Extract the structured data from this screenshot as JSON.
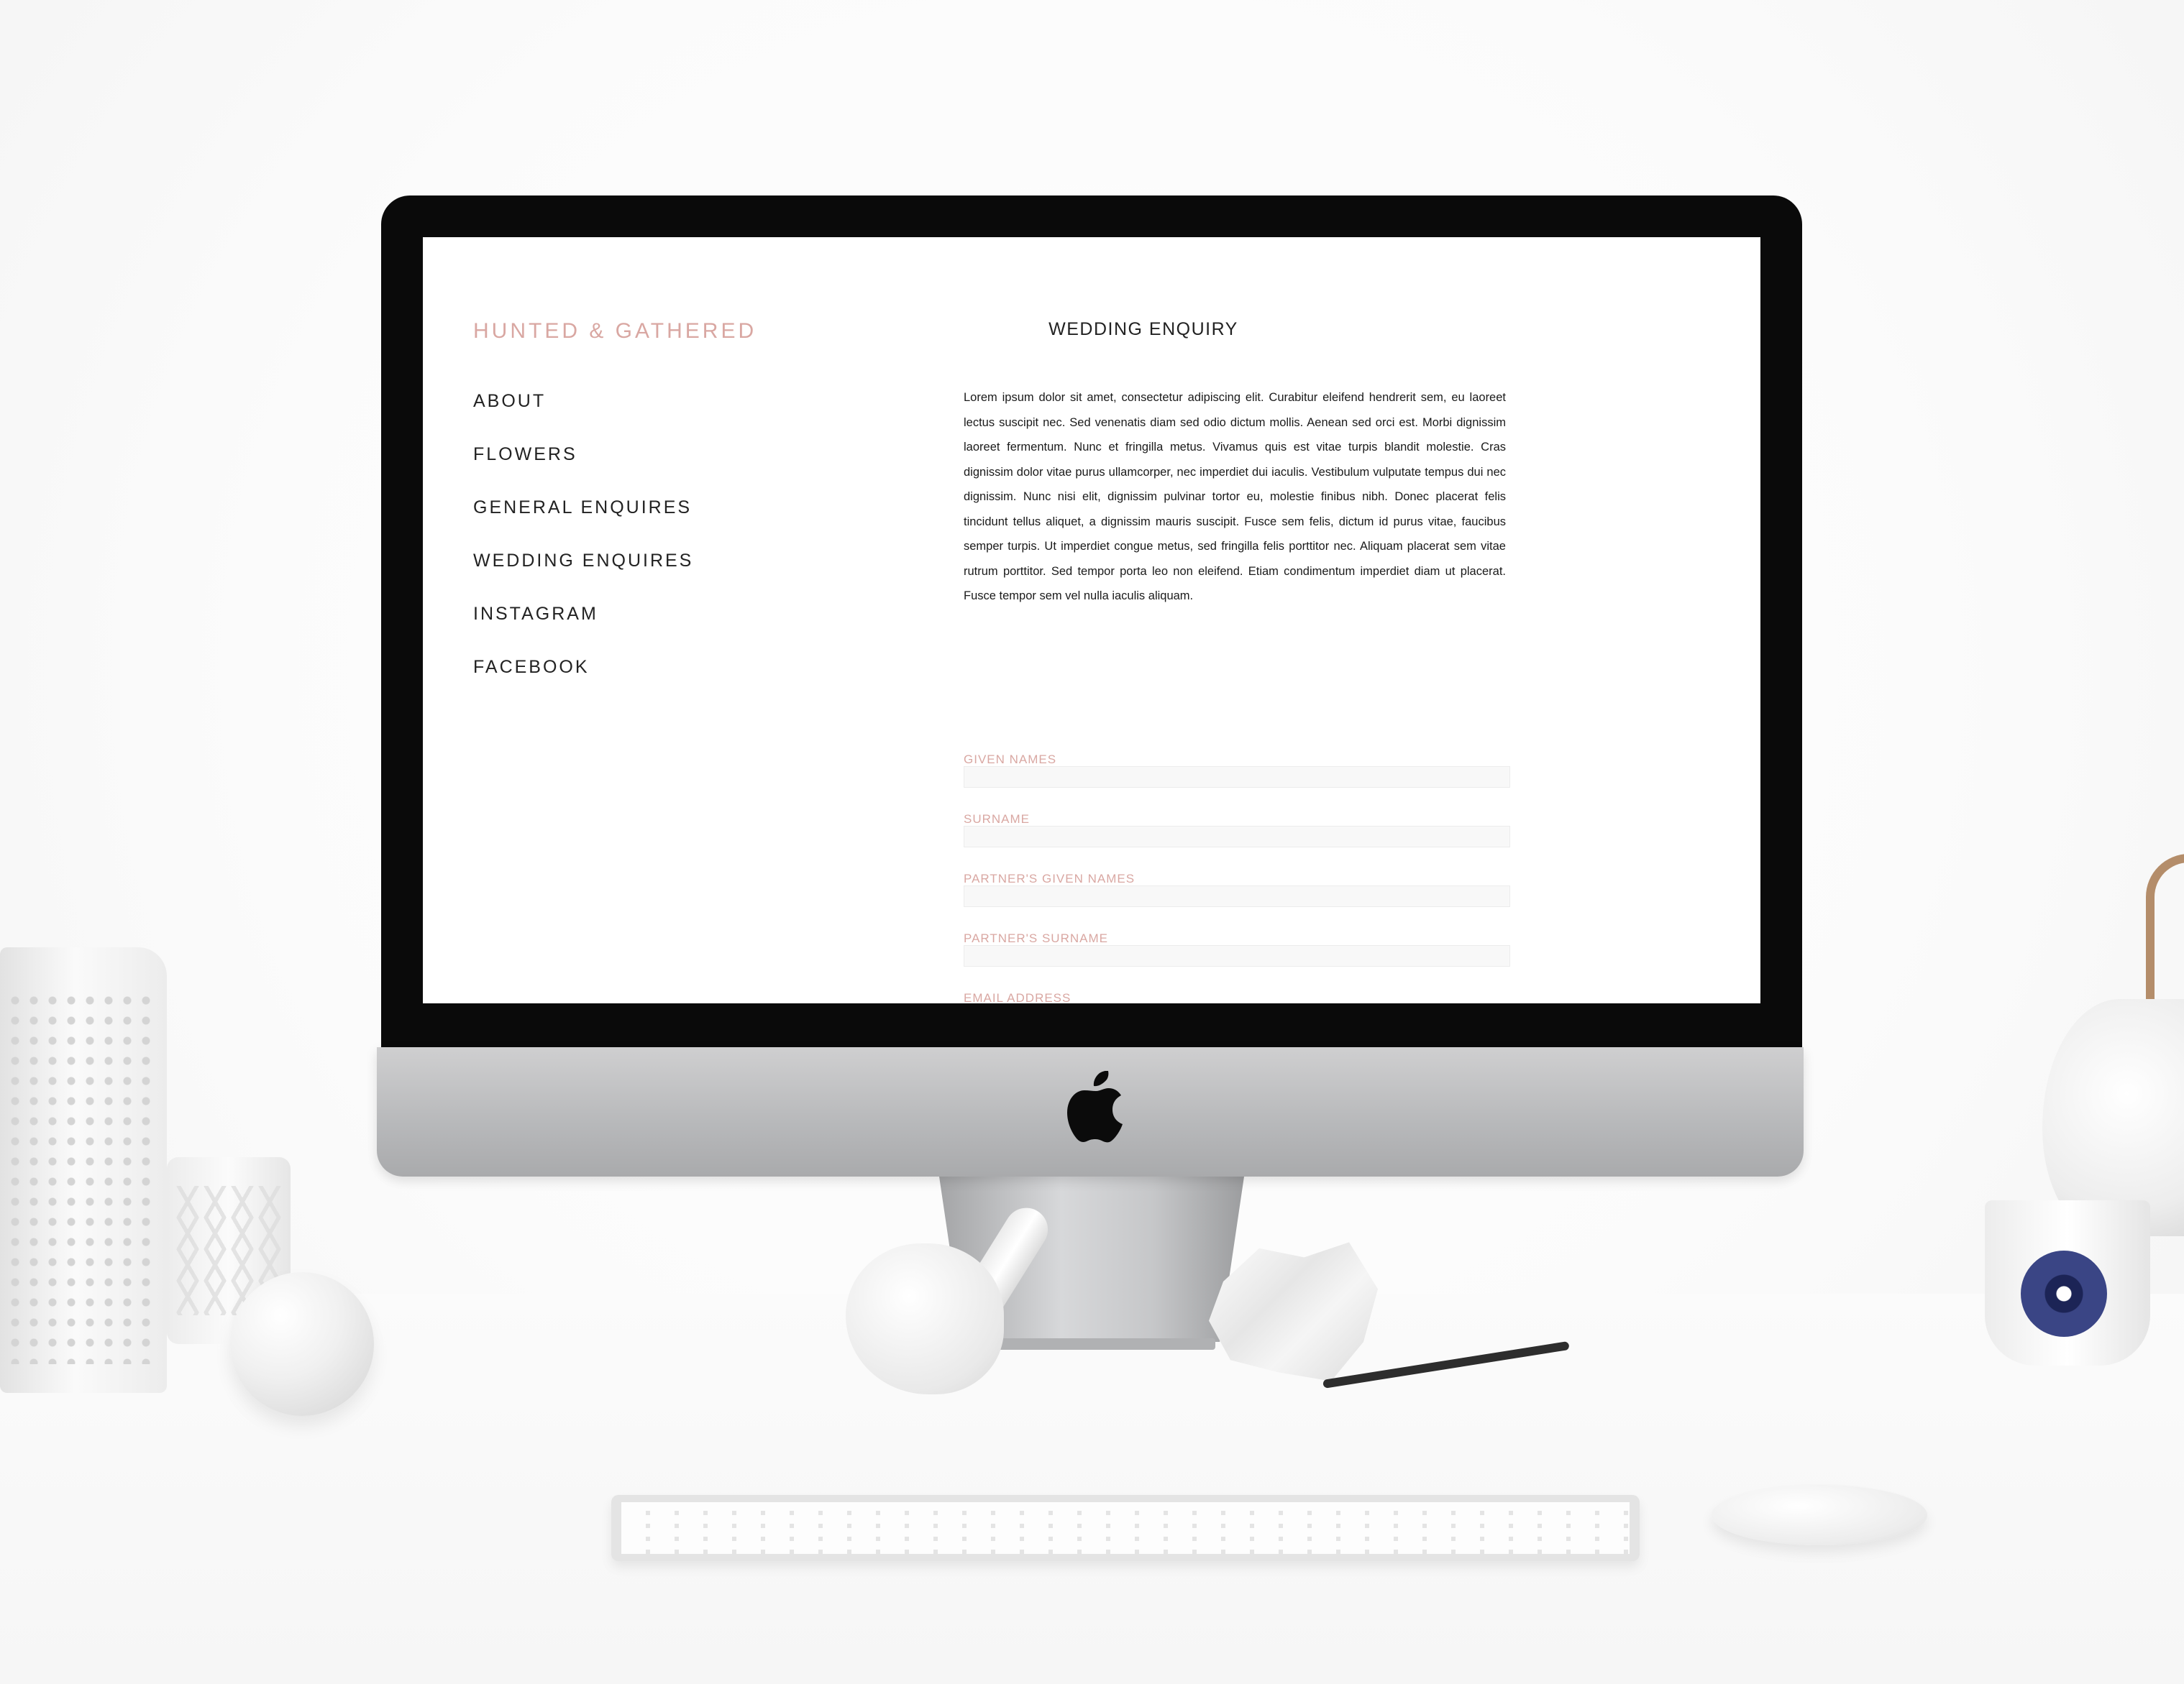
{
  "site": {
    "brand": "HUNTED & GATHERED",
    "nav": [
      "ABOUT",
      "FLOWERS",
      "GENERAL ENQUIRES",
      "WEDDING ENQUIRES",
      "INSTAGRAM",
      "FACEBOOK"
    ]
  },
  "main": {
    "title": "WEDDING ENQUIRY",
    "intro": "Lorem ipsum dolor sit amet, consectetur adipiscing elit. Curabitur eleifend hendrerit sem, eu laoreet lectus suscipit nec. Sed venenatis diam sed odio dictum mollis. Aenean sed orci est. Morbi dignissim laoreet fermentum. Nunc et fringilla metus. Vivamus quis est vitae turpis blandit molestie. Cras dignissim dolor vitae purus ullamcorper, nec imperdiet dui iaculis. Vestibulum vulputate tempus dui nec dignissim. Nunc nisi elit, dignissim pulvinar tortor eu, molestie finibus nibh. Donec placerat felis tincidunt tellus aliquet, a dignissim mauris suscipit. Fusce sem felis, dictum id purus vitae, faucibus semper turpis. Ut imperdiet congue metus, sed fringilla felis porttitor nec. Aliquam placerat sem vitae rutrum porttitor. Sed tempor porta leo non eleifend. Etiam condimentum imperdiet diam ut placerat. Fusce tempor sem vel nulla iaculis aliquam."
  },
  "form": {
    "fields": [
      {
        "label": "GIVEN NAMES",
        "value": "",
        "placeholder": ""
      },
      {
        "label": "SURNAME",
        "value": "",
        "placeholder": ""
      },
      {
        "label": "PARTNER'S GIVEN NAMES",
        "value": "",
        "placeholder": ""
      },
      {
        "label": "PARTNER'S SURNAME",
        "value": "",
        "placeholder": ""
      },
      {
        "label": "EMAIL ADDRESS",
        "value": "",
        "placeholder": ""
      }
    ]
  },
  "colors": {
    "accent": "#d9a7a2",
    "text": "#222222",
    "bezel": "#0a0a0a",
    "field_background": "#f8f8f8"
  },
  "icons": {
    "device_logo": "apple-logo-icon"
  }
}
